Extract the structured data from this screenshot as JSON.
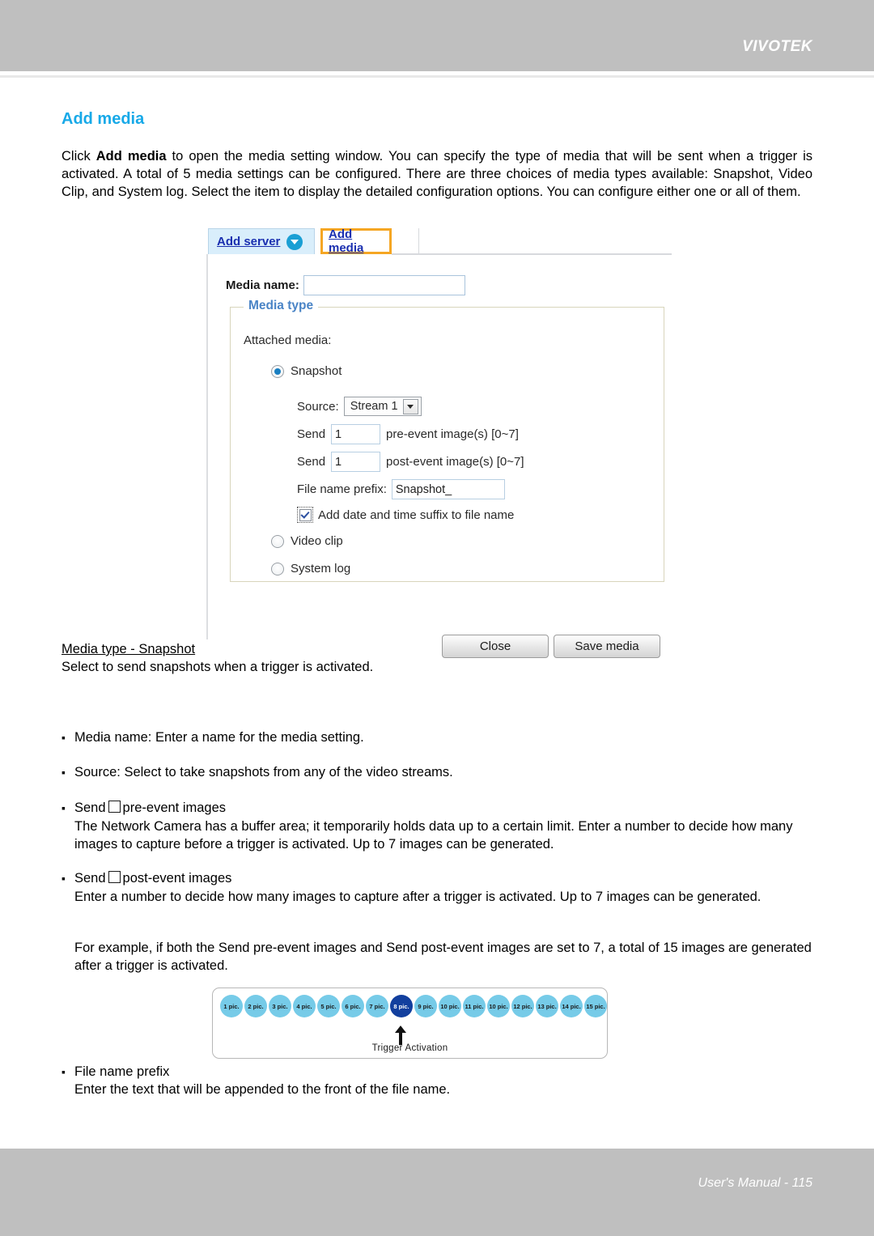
{
  "header": {
    "brand": "VIVOTEK"
  },
  "footer": {
    "text": "User's Manual - 115"
  },
  "page": {
    "section_title": "Add media",
    "intro_part1": "Click ",
    "intro_bold": "Add media",
    "intro_part2": " to open the media setting window. You can specify the type of media that will be sent when a trigger is activated. A total of 5 media settings can be configured. There are three choices of media types available: Snapshot, Video Clip, and System log. Select the item to display the detailed configuration options. You can configure either one or all of them."
  },
  "dialog": {
    "tabs": [
      {
        "label": "Add server",
        "state": "inactive",
        "has_dropdown": true
      },
      {
        "label": "Add media",
        "state": "active",
        "has_dropdown": false
      }
    ],
    "media_name": {
      "label": "Media name:",
      "value": "",
      "placeholder": ""
    },
    "media_type": {
      "legend": "Media type",
      "attached_label": "Attached media:",
      "options": [
        {
          "label": "Snapshot",
          "selected": true
        },
        {
          "label": "Video clip",
          "selected": false
        },
        {
          "label": "System log",
          "selected": false
        }
      ],
      "snapshot": {
        "source_label": "Source:",
        "source_value": "Stream 1",
        "pre_send_label": "Send",
        "pre_value": "1",
        "pre_suffix": "pre-event image(s) [0~7]",
        "post_send_label": "Send",
        "post_value": "1",
        "post_suffix": "post-event image(s) [0~7]",
        "prefix_label": "File name prefix:",
        "prefix_value": "Snapshot_",
        "suffix_checkbox_label": "Add date and time suffix to file name",
        "suffix_checked": true
      }
    },
    "buttons": {
      "close": "Close",
      "save": "Save media"
    }
  },
  "body": {
    "mediatype_head": "Media type - Snapshot ",
    "mediatype_sub": "Select to send snapshots when a trigger is activated.",
    "bullet_media_name": "Media name: Enter a name for the media setting.",
    "bullet_source": "Source: Select to take snapshots from any of the video streams.",
    "bullet_pre_a": "Send",
    "bullet_pre_b": "pre-event images",
    "para_pre": "The Network Camera has a buffer area; it temporarily holds data up to a certain limit. Enter a number to decide how many images to capture before a trigger is activated. Up to 7 images can be generated.",
    "bullet_post_a": "Send",
    "bullet_post_b": "post-event images",
    "para_post": "Enter a number to decide how many images to capture after a trigger is activated. Up to 7 images can be generated.",
    "para_example": "For example, if both the Send pre-event images and Send post-event images are set to 7, a total of 15 images are generated after a trigger is activated.",
    "bullet_prefix": "File name prefix",
    "para_prefix": "Enter the text that will be appended to the front of the file name."
  },
  "diagram": {
    "caption": "Trigger Activation",
    "highlight_index": 7,
    "circles": [
      "1 pic.",
      "2 pic.",
      "3 pic.",
      "4 pic.",
      "5 pic.",
      "6 pic.",
      "7 pic.",
      "8 pic.",
      "9 pic.",
      "10 pic.",
      "11 pic.",
      "10 pic.",
      "12 pic.",
      "13 pic.",
      "14 pic.",
      "15 pic."
    ]
  },
  "colors": {
    "accent_blue": "#17a9e8",
    "header_gray": "#bfbfbf",
    "tab_highlight": "#f5a623",
    "circle_blue": "#76cbe8",
    "circle_highlight": "#123f9e"
  }
}
